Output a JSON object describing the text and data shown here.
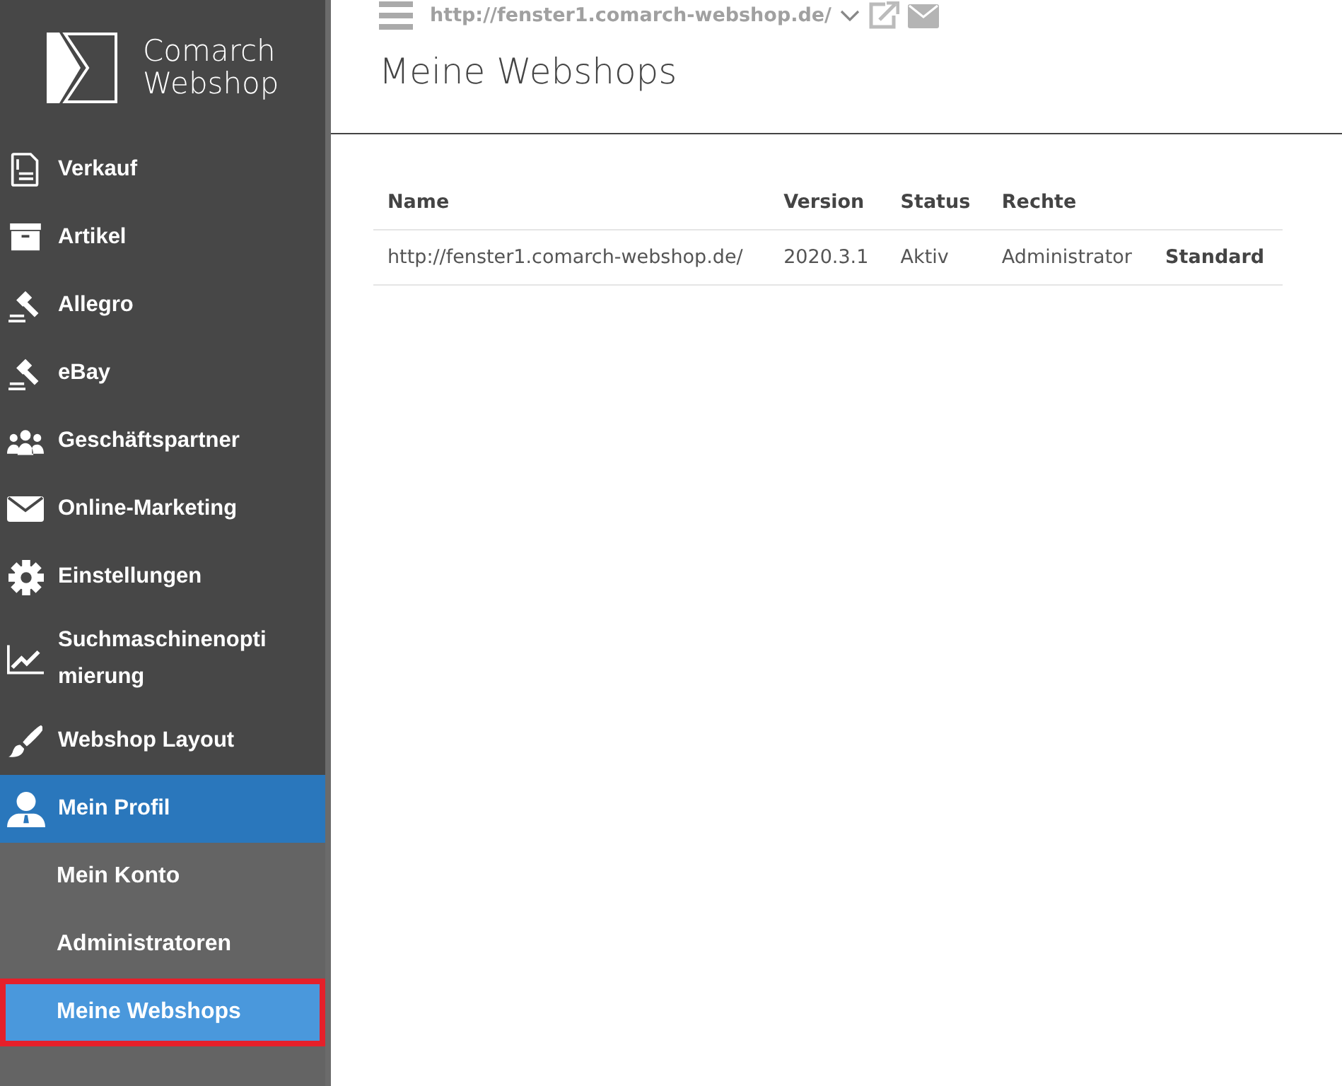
{
  "logo": {
    "line1": "Comarch",
    "line2": "Webshop"
  },
  "nav": [
    {
      "label": "Verkauf",
      "kind": "receipt",
      "selected": false
    },
    {
      "label": "Artikel",
      "kind": "archive",
      "selected": false
    },
    {
      "label": "Allegro",
      "kind": "gavel",
      "selected": false
    },
    {
      "label": "eBay",
      "kind": "gavel",
      "selected": false
    },
    {
      "label": "Geschäftspartner",
      "kind": "users",
      "selected": false
    },
    {
      "label": "Online-Marketing",
      "kind": "mail",
      "selected": false
    },
    {
      "label": "Einstellungen",
      "kind": "gear",
      "selected": false
    },
    {
      "label": "Suchmaschinenoptimierung",
      "kind": "chart",
      "selected": false
    },
    {
      "label": "Webshop Layout",
      "kind": "brush",
      "selected": false
    },
    {
      "label": "Mein Profil",
      "kind": "user",
      "selected": true,
      "children": [
        {
          "label": "Mein Konto",
          "selected": false,
          "highlighted": false
        },
        {
          "label": "Administratoren",
          "selected": false,
          "highlighted": false
        },
        {
          "label": "Meine Webshops",
          "selected": true,
          "highlighted": true
        }
      ]
    }
  ],
  "topbar": {
    "url": "http://fenster1.comarch-webshop.de/"
  },
  "page_title": "Meine Webshops",
  "table": {
    "columns": [
      "Name",
      "Version",
      "Status",
      "Rechte",
      ""
    ],
    "rows": [
      {
        "cells": [
          "http://fenster1.comarch-webshop.de/",
          "2020.3.1",
          "Aktiv",
          "Administrator",
          "Standard"
        ]
      }
    ]
  }
}
